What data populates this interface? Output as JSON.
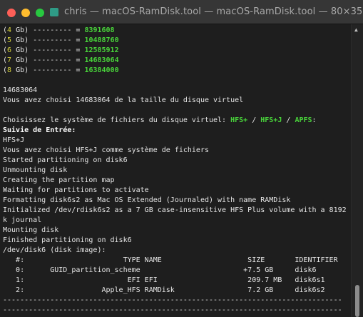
{
  "window": {
    "title": "chris — macOS-RamDisk.tool — macOS-RamDisk.tool — 80×35"
  },
  "terminal": {
    "sizes": [
      {
        "n": "4",
        "unit": "Gb",
        "value": "8391608"
      },
      {
        "n": "5",
        "unit": "Gb",
        "value": "10488760"
      },
      {
        "n": "6",
        "unit": "Gb",
        "value": "12585912"
      },
      {
        "n": "7",
        "unit": "Gb",
        "value": "14683064"
      },
      {
        "n": "8",
        "unit": "Gb",
        "value": "16384000"
      }
    ],
    "input_value": "14683064",
    "chosen_size": "Vous avez choisi 14683064 de la taille du disque virtuel",
    "fs_prompt": "Choisissez le système de fichiers du disque virtuel:",
    "fs_options": [
      "HFS+",
      "HFS+J",
      "APFS"
    ],
    "input_heading": "Suivie de Entrée:",
    "fs_input": "HFS+J",
    "log": [
      "Vous avez choisi HFS+J comme système de fichiers",
      "Started partitioning on disk6",
      "Unmounting disk",
      "Creating the partition map",
      "Waiting for partitions to activate",
      "Formatting disk6s2 as Mac OS Extended (Journaled) with name RAMDisk",
      "Initialized /dev/rdisk6s2 as a 7 GB case-insensitive HFS Plus volume with a 8192",
      "k journal",
      "Mounting disk",
      "Finished partitioning on disk6",
      "/dev/disk6 (disk image):"
    ],
    "table": {
      "header": "   #:                       TYPE NAME                    SIZE       IDENTIFIER",
      "rows": [
        "   0:      GUID_partition_scheme                        +7.5 GB     disk6",
        "   1:                        EFI EFI                     209.7 MB   disk6s1",
        "   2:                  Apple_HFS RAMDisk                 7.2 GB     disk6s2"
      ]
    },
    "separator": "-------------------------------------------------------------------------------"
  },
  "colors": {
    "background": "#1e1e1e",
    "text": "#e6e6e6",
    "yellow": "#d7d33a",
    "green": "#48d33a",
    "titlebar": "#363636"
  }
}
